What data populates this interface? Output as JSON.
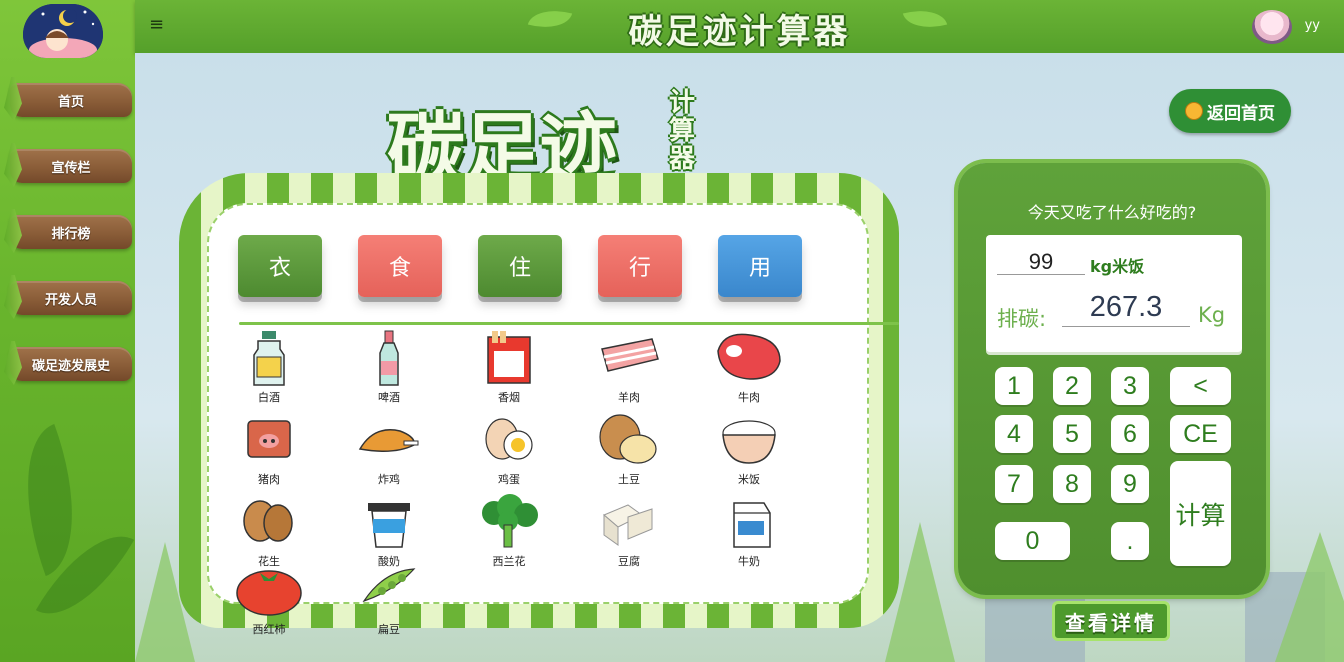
{
  "app": {
    "title": "碳足迹计算器"
  },
  "sidebar": {
    "items": [
      {
        "label": "首页"
      },
      {
        "label": "宣传栏"
      },
      {
        "label": "排行榜"
      },
      {
        "label": "开发人员"
      },
      {
        "label": "碳足迹发展史"
      }
    ]
  },
  "topbar": {
    "menu_icon": "≡",
    "user_name": "yy"
  },
  "logo": {
    "main": "碳足迹",
    "side": [
      "计",
      "算",
      "器"
    ]
  },
  "categories": [
    {
      "label": "衣",
      "color": "green"
    },
    {
      "label": "食",
      "color": "red"
    },
    {
      "label": "住",
      "color": "green"
    },
    {
      "label": "行",
      "color": "red"
    },
    {
      "label": "用",
      "color": "blue"
    }
  ],
  "foods": [
    {
      "label": "白酒",
      "icon": "liquor-bottle-icon"
    },
    {
      "label": "啤酒",
      "icon": "beer-bottle-icon"
    },
    {
      "label": "香烟",
      "icon": "cigarette-pack-icon"
    },
    {
      "label": "羊肉",
      "icon": "mutton-icon"
    },
    {
      "label": "牛肉",
      "icon": "beef-icon"
    },
    {
      "label": "猪肉",
      "icon": "pork-icon"
    },
    {
      "label": "炸鸡",
      "icon": "fried-chicken-icon"
    },
    {
      "label": "鸡蛋",
      "icon": "egg-icon"
    },
    {
      "label": "土豆",
      "icon": "potato-icon"
    },
    {
      "label": "米饭",
      "icon": "rice-bowl-icon"
    },
    {
      "label": "花生",
      "icon": "peanut-icon"
    },
    {
      "label": "酸奶",
      "icon": "yogurt-icon"
    },
    {
      "label": "西兰花",
      "icon": "broccoli-icon"
    },
    {
      "label": "豆腐",
      "icon": "tofu-icon"
    },
    {
      "label": "牛奶",
      "icon": "milk-carton-icon"
    },
    {
      "label": "西红柿",
      "icon": "tomato-icon"
    },
    {
      "label": "扁豆",
      "icon": "bean-pod-icon"
    }
  ],
  "calculator": {
    "question": "今天又吃了什么好吃的?",
    "quantity": "99",
    "unit_label": "kg米饭",
    "emission_label": "排碳:",
    "emission_value": "267.3",
    "emission_unit": "Kg",
    "keys": {
      "k1": "1",
      "k2": "2",
      "k3": "3",
      "back": "<",
      "k4": "4",
      "k5": "5",
      "k6": "6",
      "ce": "CE",
      "k7": "7",
      "k8": "8",
      "k9": "9",
      "calc": "计算",
      "k0": "0",
      "dot": "."
    }
  },
  "buttons": {
    "return_home": "返回首页",
    "view_details": "查看详情"
  }
}
